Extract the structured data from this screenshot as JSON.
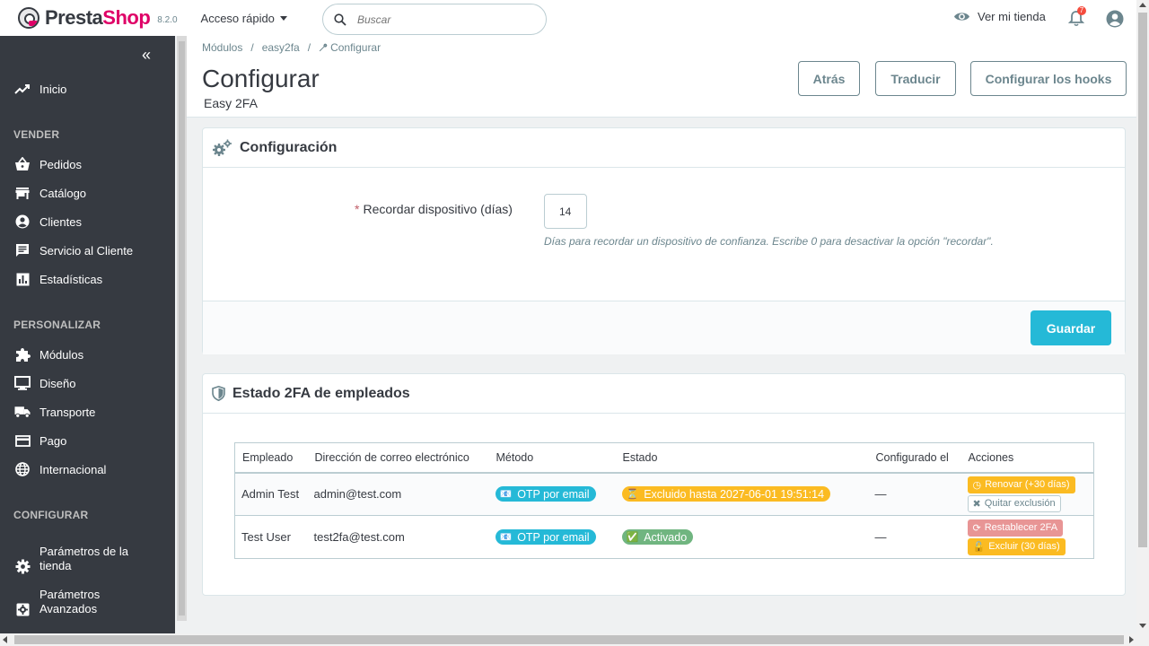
{
  "header": {
    "logo_text_presta": "Presta",
    "logo_text_shop": "Shop",
    "version": "8.2.0",
    "quick_access": "Acceso rápido",
    "search_placeholder": "Buscar",
    "view_store": "Ver mi tienda",
    "notifications_count": "7"
  },
  "sidebar": {
    "home": "Inicio",
    "sections": [
      "VENDER",
      "PERSONALIZAR",
      "CONFIGURAR"
    ],
    "sell_items": [
      "Pedidos",
      "Catálogo",
      "Clientes",
      "Servicio al Cliente",
      "Estadísticas"
    ],
    "customize_items": [
      "Módulos",
      "Diseño",
      "Transporte",
      "Pago",
      "Internacional"
    ],
    "configure_items": [
      "Parámetros de la tienda",
      "Parámetros Avanzados"
    ]
  },
  "breadcrumb": [
    "Módulos",
    "easy2fa",
    "Configurar"
  ],
  "page": {
    "title": "Configurar",
    "subtitle": "Easy 2FA",
    "buttons": [
      "Atrás",
      "Traducir",
      "Configurar los hooks"
    ]
  },
  "config_panel": {
    "title": "Configuración",
    "required_mark": "*",
    "field_label": "Recordar dispositivo (días)",
    "field_value": "14",
    "help": "Días para recordar un dispositivo de confianza. Escribe 0 para desactivar la opción \"recordar\".",
    "save": "Guardar"
  },
  "status_panel": {
    "title": "Estado 2FA de empleados",
    "columns": [
      "Empleado",
      "Dirección de correo electrónico",
      "Método",
      "Estado",
      "Configurado el",
      "Acciones"
    ],
    "rows": [
      {
        "name": "Admin Test",
        "email": "admin@test.com",
        "method": "OTP por email",
        "method_icon": "📧",
        "status": "Excluido hasta 2027-06-01 19:51:14",
        "status_icon": "⏳",
        "configured": "—",
        "action_1": "Renovar (+30 días)",
        "action_2": "Quitar exclusión"
      },
      {
        "name": "Test User",
        "email": "test2fa@test.com",
        "method": "OTP por email",
        "method_icon": "📧",
        "status": "Activado",
        "status_icon": "✅",
        "configured": "—",
        "action_1": "Restablecer 2FA",
        "action_2": "Excluir (30 días)"
      }
    ]
  },
  "colors": {
    "brand_pink": "#df0067",
    "primary": "#25b9d7",
    "sidebar_bg": "#363a41",
    "warning": "#fbbb22",
    "success": "#70b580",
    "danger": "#e89595"
  }
}
